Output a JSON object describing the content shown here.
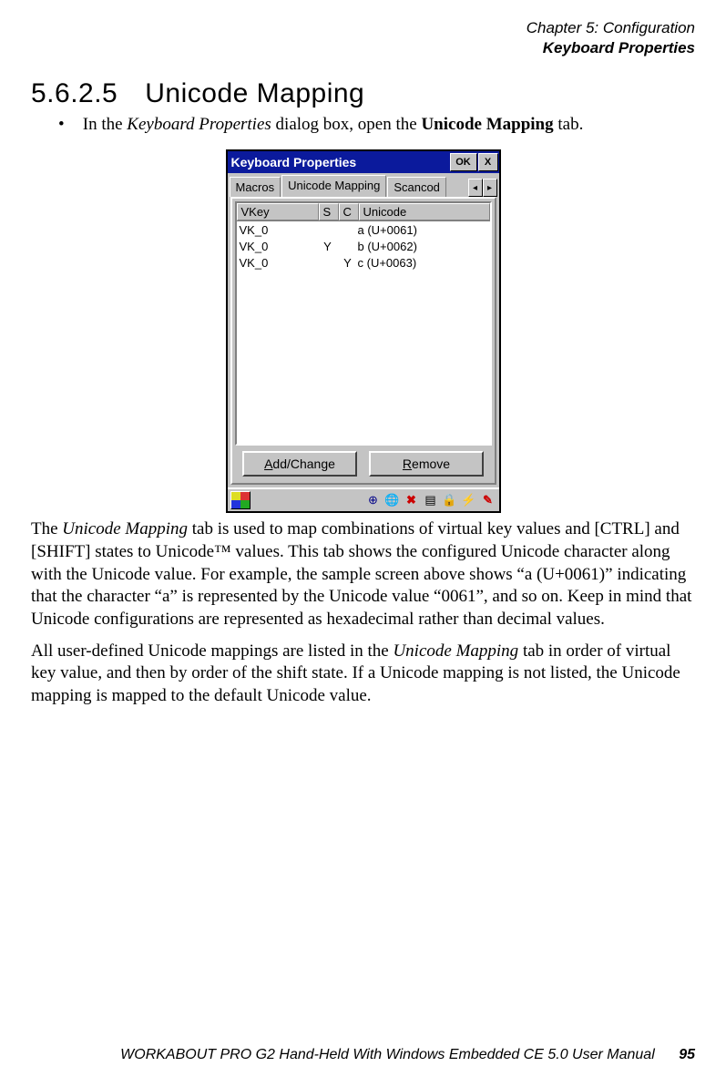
{
  "header": {
    "chapter": "Chapter 5: Configuration",
    "section": "Keyboard Properties"
  },
  "heading": {
    "number": "5.6.2.5",
    "title": "Unicode Mapping"
  },
  "bullet": {
    "pre": "In the ",
    "em": "Keyboard Properties",
    "mid": " dialog box, open the ",
    "strong": "Unicode Mapping",
    "post": " tab."
  },
  "dialog": {
    "title": "Keyboard Properties",
    "ok": "OK",
    "close": "X",
    "tabs": {
      "macros": "Macros",
      "unicode": "Unicode Mapping",
      "scancode": "Scancod"
    },
    "columns": {
      "vkey": "VKey",
      "s": "S",
      "c": "C",
      "unicode": "Unicode"
    },
    "rows": [
      {
        "vkey": "VK_0",
        "s": "",
        "c": "",
        "unicode": "a (U+0061)"
      },
      {
        "vkey": "VK_0",
        "s": "Y",
        "c": "",
        "unicode": "b (U+0062)"
      },
      {
        "vkey": "VK_0",
        "s": "",
        "c": "Y",
        "unicode": "c (U+0063)"
      }
    ],
    "buttons": {
      "addchange_pre": "A",
      "addchange_rest": "dd/Change",
      "remove_pre": "R",
      "remove_rest": "emove"
    }
  },
  "para1": {
    "p1": "The ",
    "em": "Unicode Mapping",
    "p2": " tab is used to map combinations of virtual key values and [CTRL] and [SHIFT] states to Unicode™ values. This tab shows the configured Unicode character along with the Unicode value. For example, the sample screen above shows “a (U+0061)” indicating that the character “a” is represented by the Unicode value “0061”, and so on. Keep in mind that Unicode configurations are represented as hexadecimal rather than decimal values."
  },
  "para2": {
    "p1": "All user-defined Unicode mappings are listed in the ",
    "em": "Unicode Mapping",
    "p2": " tab in order of virtual key value, and then by order of the shift state. If a Unicode mapping is not listed, the Unicode mapping is mapped to the default Unicode value."
  },
  "footer": {
    "text": "WORKABOUT PRO G2 Hand-Held With Windows Embedded CE 5.0 User Manual",
    "page": "95"
  }
}
